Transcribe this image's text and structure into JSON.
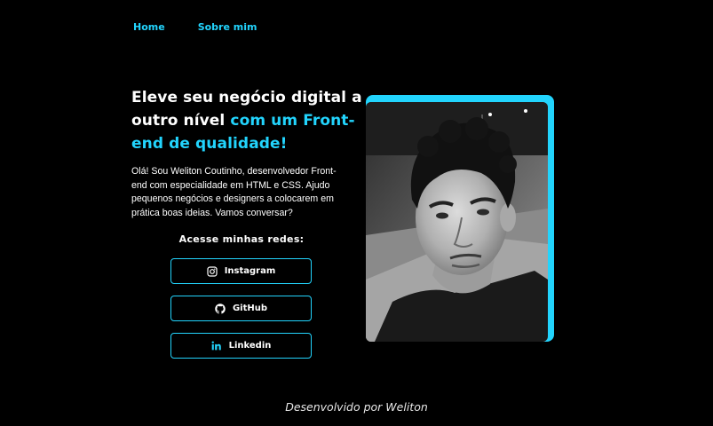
{
  "nav": {
    "home": "Home",
    "about": "Sobre mim"
  },
  "hero": {
    "headline_part1": "Eleve seu negócio digital a outro nível ",
    "headline_highlight": "com um Front-end de qualidade!",
    "intro": "Olá! Sou Weliton Coutinho, desenvolvedor Front-end com especialidade em HTML e CSS. Ajudo pequenos negócios e designers a colocarem em prática boas ideias. Vamos conversar?",
    "photo_icon": "profile-photo"
  },
  "social": {
    "title": "Acesse minhas redes:",
    "links": [
      {
        "label": "Instagram",
        "icon": "instagram-icon"
      },
      {
        "label": "GitHub",
        "icon": "github-icon"
      },
      {
        "label": "Linkedin",
        "icon": "linkedin-icon"
      }
    ]
  },
  "footer": {
    "text": "Desenvolvido por Weliton"
  },
  "colors": {
    "accent": "#22d4fd",
    "background": "#000000",
    "text": "#ffffff"
  }
}
